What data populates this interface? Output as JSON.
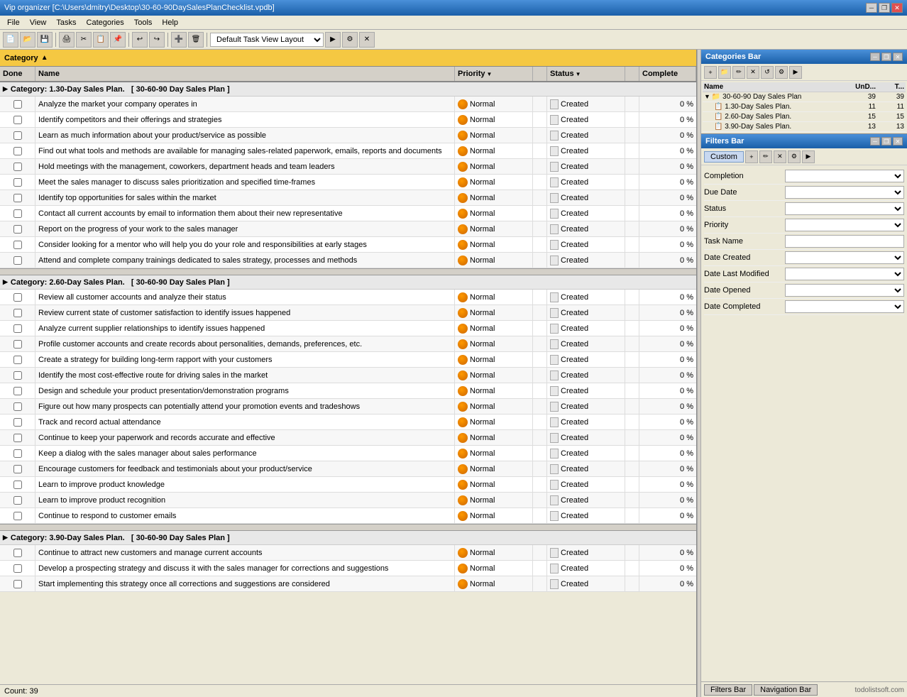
{
  "titleBar": {
    "text": "Vip organizer [C:\\Users\\dmitry\\Desktop\\30-60-90DaySalesPlanChecklist.vpdb]",
    "buttons": [
      "minimize",
      "restore",
      "close"
    ]
  },
  "menuBar": {
    "items": [
      "File",
      "View",
      "Tasks",
      "Categories",
      "Tools",
      "Help"
    ]
  },
  "toolbar": {
    "layoutLabel": "Default Task View Layout"
  },
  "categoryHeader": {
    "text": "Category"
  },
  "tableColumns": {
    "done": "Done",
    "name": "Name",
    "priority": "Priority",
    "status": "Status",
    "complete": "Complete"
  },
  "statusBar": {
    "count": "Count: 39"
  },
  "categories": [
    {
      "name": "1.30-Day Sales Plan.",
      "parentLabel": "[ 30-60-90 Day Sales Plan ]",
      "tasks": [
        {
          "name": "Analyze the market your company operates in",
          "priority": "Normal",
          "status": "Created",
          "complete": "0 %"
        },
        {
          "name": "Identify competitors and their offerings and strategies",
          "priority": "Normal",
          "status": "Created",
          "complete": "0 %"
        },
        {
          "name": "Learn as much information about your product/service as possible",
          "priority": "Normal",
          "status": "Created",
          "complete": "0 %"
        },
        {
          "name": "Find out what tools and methods are available for managing sales-related paperwork, emails, reports and documents",
          "priority": "Normal",
          "status": "Created",
          "complete": "0 %"
        },
        {
          "name": "Hold meetings with the management, coworkers, department heads and team leaders",
          "priority": "Normal",
          "status": "Created",
          "complete": "0 %"
        },
        {
          "name": "Meet the sales manager to discuss sales prioritization and specified time-frames",
          "priority": "Normal",
          "status": "Created",
          "complete": "0 %"
        },
        {
          "name": "Identify top  opportunities for sales within the market",
          "priority": "Normal",
          "status": "Created",
          "complete": "0 %"
        },
        {
          "name": "Contact all current accounts by email to information them about their new representative",
          "priority": "Normal",
          "status": "Created",
          "complete": "0 %"
        },
        {
          "name": "Report on the progress of your work to the sales manager",
          "priority": "Normal",
          "status": "Created",
          "complete": "0 %"
        },
        {
          "name": "Consider looking for a mentor who will help you do your role and responsibilities at early stages",
          "priority": "Normal",
          "status": "Created",
          "complete": "0 %"
        },
        {
          "name": "Attend and complete company trainings dedicated to sales strategy, processes and methods",
          "priority": "Normal",
          "status": "Created",
          "complete": "0 %"
        }
      ]
    },
    {
      "name": "2.60-Day Sales Plan.",
      "parentLabel": "[ 30-60-90 Day Sales Plan ]",
      "tasks": [
        {
          "name": "Review all  customer accounts and analyze their status",
          "priority": "Normal",
          "status": "Created",
          "complete": "0 %"
        },
        {
          "name": "Review current state of customer satisfaction  to identify issues happened",
          "priority": "Normal",
          "status": "Created",
          "complete": "0 %"
        },
        {
          "name": "Analyze current supplier relationships to identify issues happened",
          "priority": "Normal",
          "status": "Created",
          "complete": "0 %"
        },
        {
          "name": "Profile customer accounts and create records about personalities, demands, preferences, etc.",
          "priority": "Normal",
          "status": "Created",
          "complete": "0 %"
        },
        {
          "name": "Create a strategy for building long-term rapport with your customers",
          "priority": "Normal",
          "status": "Created",
          "complete": "0 %"
        },
        {
          "name": "Identify the most cost-effective route for driving sales in the market",
          "priority": "Normal",
          "status": "Created",
          "complete": "0 %"
        },
        {
          "name": "Design and schedule your product presentation/demonstration programs",
          "priority": "Normal",
          "status": "Created",
          "complete": "0 %"
        },
        {
          "name": "Figure out how many prospects can potentially attend your promotion events and tradeshows",
          "priority": "Normal",
          "status": "Created",
          "complete": "0 %"
        },
        {
          "name": "Track and record actual attendance",
          "priority": "Normal",
          "status": "Created",
          "complete": "0 %"
        },
        {
          "name": "Continue to keep your paperwork and records accurate and effective",
          "priority": "Normal",
          "status": "Created",
          "complete": "0 %"
        },
        {
          "name": "Keep a dialog with the sales manager about sales performance",
          "priority": "Normal",
          "status": "Created",
          "complete": "0 %"
        },
        {
          "name": "Encourage customers for feedback and testimonials about your product/service",
          "priority": "Normal",
          "status": "Created",
          "complete": "0 %"
        },
        {
          "name": "Learn to improve product knowledge",
          "priority": "Normal",
          "status": "Created",
          "complete": "0 %"
        },
        {
          "name": "Learn to improve product recognition",
          "priority": "Normal",
          "status": "Created",
          "complete": "0 %"
        },
        {
          "name": "Continue to respond to customer emails",
          "priority": "Normal",
          "status": "Created",
          "complete": "0 %"
        }
      ]
    },
    {
      "name": "3.90-Day Sales Plan.",
      "parentLabel": "[ 30-60-90 Day Sales Plan ]",
      "tasks": [
        {
          "name": "Continue to attract new customers and manage current accounts",
          "priority": "Normal",
          "status": "Created",
          "complete": "0 %"
        },
        {
          "name": "Develop a prospecting strategy and discuss it with the sales manager for corrections and suggestions",
          "priority": "Normal",
          "status": "Created",
          "complete": "0 %"
        },
        {
          "name": "Start implementing this strategy once all corrections and suggestions are considered",
          "priority": "Normal",
          "status": "Created",
          "complete": "0 %"
        }
      ]
    }
  ],
  "rightPanel": {
    "categoriesBar": {
      "title": "Categories Bar",
      "treeHeader": {
        "name": "Name",
        "undone": "UnD...",
        "total": "T..."
      },
      "treeItems": [
        {
          "label": "30-60-90 Day Sales Plan",
          "undone": "39",
          "total": "39",
          "indent": 0,
          "icon": "folder"
        },
        {
          "label": "1.30-Day Sales Plan.",
          "undone": "11",
          "total": "11",
          "indent": 1,
          "icon": "list"
        },
        {
          "label": "2.60-Day Sales Plan.",
          "undone": "15",
          "total": "15",
          "indent": 1,
          "icon": "list"
        },
        {
          "label": "3.90-Day Sales Plan.",
          "undone": "13",
          "total": "13",
          "indent": 1,
          "icon": "list"
        }
      ]
    },
    "filtersBar": {
      "title": "Filters Bar",
      "activeTab": "Custom",
      "filters": [
        {
          "label": "Completion",
          "type": "select"
        },
        {
          "label": "Due Date",
          "type": "select"
        },
        {
          "label": "Status",
          "type": "select"
        },
        {
          "label": "Priority",
          "type": "select"
        },
        {
          "label": "Task Name",
          "type": "input"
        },
        {
          "label": "Date Created",
          "type": "select"
        },
        {
          "label": "Date Last Modified",
          "type": "select"
        },
        {
          "label": "Date Opened",
          "type": "select"
        },
        {
          "label": "Date Completed",
          "type": "select"
        }
      ]
    },
    "bottomTabs": [
      "Filters Bar",
      "Navigation Bar"
    ]
  },
  "watermark": "todolistsoft.com"
}
